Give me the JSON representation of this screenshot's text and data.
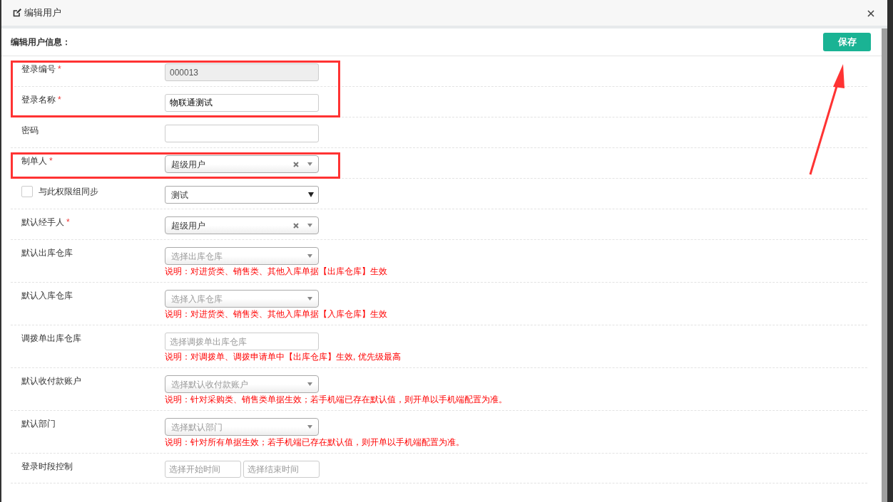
{
  "window": {
    "title": "编辑用户"
  },
  "section": {
    "title": "编辑用户信息：",
    "save_button": "保存"
  },
  "fields": [
    {
      "kind": "input",
      "label": "登录编号",
      "required_mark": "*",
      "disabled": true,
      "value": "000013",
      "highlighted": true
    },
    {
      "kind": "input",
      "label": "登录名称",
      "required_mark": "*",
      "disabled": false,
      "value": "物联通测试",
      "highlighted": true
    },
    {
      "kind": "input",
      "label": "密码",
      "disabled": false,
      "highlighted": false
    },
    {
      "kind": "select2",
      "label": "制单人",
      "required_mark": "*",
      "value": "超级用户",
      "clearable": true,
      "highlighted": true
    },
    {
      "kind": "checkbox-select",
      "label": "与此权限组同步",
      "checked": false,
      "value": "测试",
      "highlighted": false
    },
    {
      "kind": "select2",
      "label": "默认经手人",
      "required_mark": "*",
      "value": "超级用户",
      "clearable": true,
      "highlighted": false
    },
    {
      "kind": "select2",
      "label": "默认出库仓库",
      "placeholder": "选择出库仓库",
      "clearable": false,
      "note": "说明：对进货类、销售类、其他入库单据【出库仓库】生效",
      "highlighted": false
    },
    {
      "kind": "select2",
      "label": "默认入库仓库",
      "placeholder": "选择入库仓库",
      "clearable": false,
      "note": "说明：对进货类、销售类、其他入库单据【入库仓库】生效",
      "highlighted": false
    },
    {
      "kind": "input",
      "label": "调拨单出库仓库",
      "disabled": false,
      "placeholder": "选择调拨单出库仓库",
      "note": "说明：对调拨单、调拨申请单中【出库仓库】生效, 优先级最高",
      "highlighted": false
    },
    {
      "kind": "select2",
      "label": "默认收付款账户",
      "placeholder": "选择默认收付款账户",
      "clearable": false,
      "note": "说明：针对采购类、销售类单据生效；若手机端已存在默认值，则开单以手机端配置为准。",
      "highlighted": false
    },
    {
      "kind": "select2",
      "label": "默认部门",
      "placeholder": "选择默认部门",
      "clearable": false,
      "note": "说明：针对所有单据生效；若手机端已存在默认值，则开单以手机端配置为准。",
      "highlighted": false
    },
    {
      "kind": "timerange",
      "label": "登录时段控制",
      "start_placeholder": "选择开始时间",
      "end_placeholder": "选择结束时间",
      "highlighted": false
    }
  ],
  "annotation": {
    "arrow": true
  }
}
